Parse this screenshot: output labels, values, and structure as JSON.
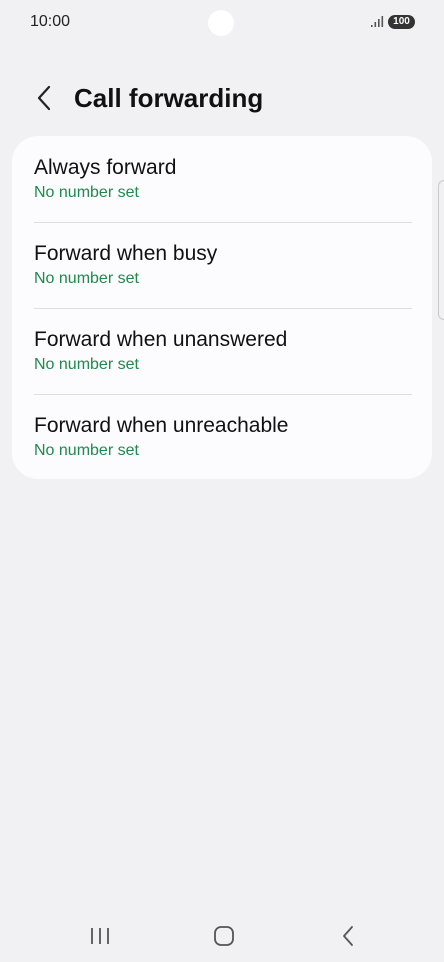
{
  "status_bar": {
    "time": "10:00",
    "battery": "100",
    "icons": [
      "signal-icon",
      "battery-icon"
    ]
  },
  "header": {
    "title": "Call forwarding",
    "back_icon": "chevron-left-icon"
  },
  "items": [
    {
      "title": "Always forward",
      "subtitle": "No number set"
    },
    {
      "title": "Forward when busy",
      "subtitle": "No number set"
    },
    {
      "title": "Forward when unanswered",
      "subtitle": "No number set"
    },
    {
      "title": "Forward when unreachable",
      "subtitle": "No number set"
    }
  ],
  "navigation": {
    "icons": [
      "recent-apps-icon",
      "home-icon",
      "back-icon"
    ]
  },
  "colors": {
    "background": "#f1f1f3",
    "card": "#fcfcfe",
    "subtitle": "#1f8a4c"
  }
}
